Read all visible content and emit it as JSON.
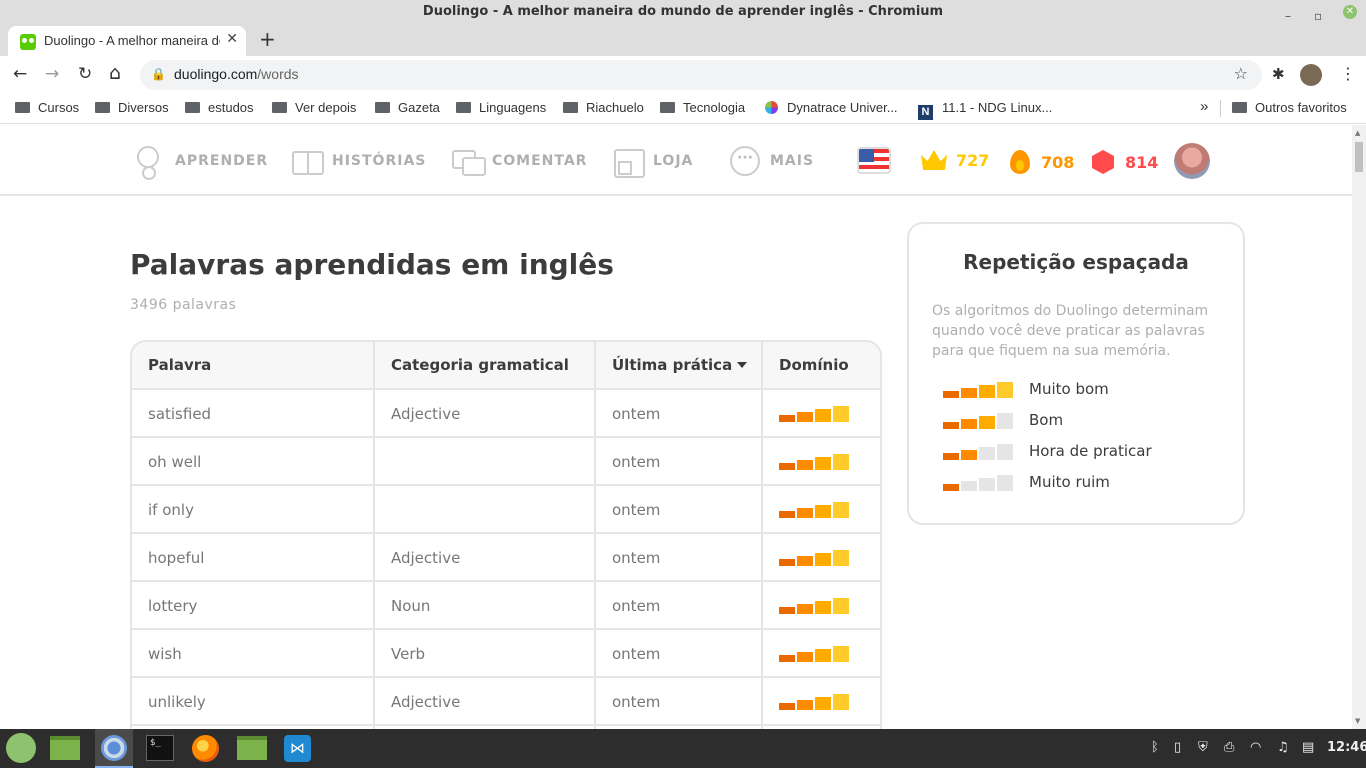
{
  "window": {
    "title": "Duolingo - A melhor maneira do mundo de aprender inglês - Chromium",
    "minimize": "–",
    "maximize": "▫",
    "close": "✕"
  },
  "browser": {
    "tab_title": "Duolingo - A melhor maneira do mundo de aprender inglês",
    "tab_close": "✕",
    "new_tab": "+",
    "url_host": "duolingo.com",
    "url_path": "/words",
    "back": "←",
    "forward": "→",
    "reload": "↻",
    "home": "⌂",
    "lock": "🔒",
    "star": "☆",
    "extensions": "✱",
    "menu": "⋮"
  },
  "bookmarks": {
    "items": [
      "Cursos",
      "Diversos",
      "estudos",
      "Ver depois",
      "Gazeta",
      "Linguagens",
      "Riachuelo",
      "Tecnologia"
    ],
    "dynatrace": "Dynatrace Univer...",
    "ndg": "11.1 - NDG Linux...",
    "ndg_icon": "N",
    "overflow": "»",
    "other": "Outros favoritos"
  },
  "duo_nav": {
    "learn": "APRENDER",
    "stories": "HISTÓRIAS",
    "comment": "COMENTAR",
    "shop": "LOJA",
    "more": "MAIS",
    "more_icon": "···",
    "crowns": "727",
    "streak": "708",
    "gems": "814"
  },
  "colors": {
    "crown": "#ffc800",
    "streak": "#ff9600",
    "gems": "#ff4b4b",
    "strength_1": "#ea6a00",
    "strength_2": "#ff8a00",
    "strength_3": "#ffab00",
    "strength_4": "#ffcb2b"
  },
  "main": {
    "title": "Palavras aprendidas em inglês",
    "count": "3496 palavras"
  },
  "table": {
    "headers": {
      "word": "Palavra",
      "category": "Categoria gramatical",
      "last_practice": "Última prática",
      "mastery": "Domínio"
    },
    "rows": [
      {
        "word": "satisfied",
        "category": "Adjective",
        "last": "ontem",
        "strength": 4
      },
      {
        "word": "oh well",
        "category": "",
        "last": "ontem",
        "strength": 4
      },
      {
        "word": "if only",
        "category": "",
        "last": "ontem",
        "strength": 4
      },
      {
        "word": "hopeful",
        "category": "Adjective",
        "last": "ontem",
        "strength": 4
      },
      {
        "word": "lottery",
        "category": "Noun",
        "last": "ontem",
        "strength": 4
      },
      {
        "word": "wish",
        "category": "Verb",
        "last": "ontem",
        "strength": 4
      },
      {
        "word": "unlikely",
        "category": "Adjective",
        "last": "ontem",
        "strength": 4
      },
      {
        "word": "",
        "category": "",
        "last": "",
        "strength": 0
      }
    ]
  },
  "card": {
    "title": "Repetição espaçada",
    "description": "Os algoritmos do Duolingo determinam quando você deve praticar as palavras para que fiquem na sua memória.",
    "legend": [
      {
        "label": "Muito bom",
        "strength": 4
      },
      {
        "label": "Bom",
        "strength": 3
      },
      {
        "label": "Hora de praticar",
        "strength": 2
      },
      {
        "label": "Muito ruim",
        "strength": 1
      }
    ]
  },
  "taskbar": {
    "terminal_prompt": "$_",
    "clock": "12:46"
  }
}
